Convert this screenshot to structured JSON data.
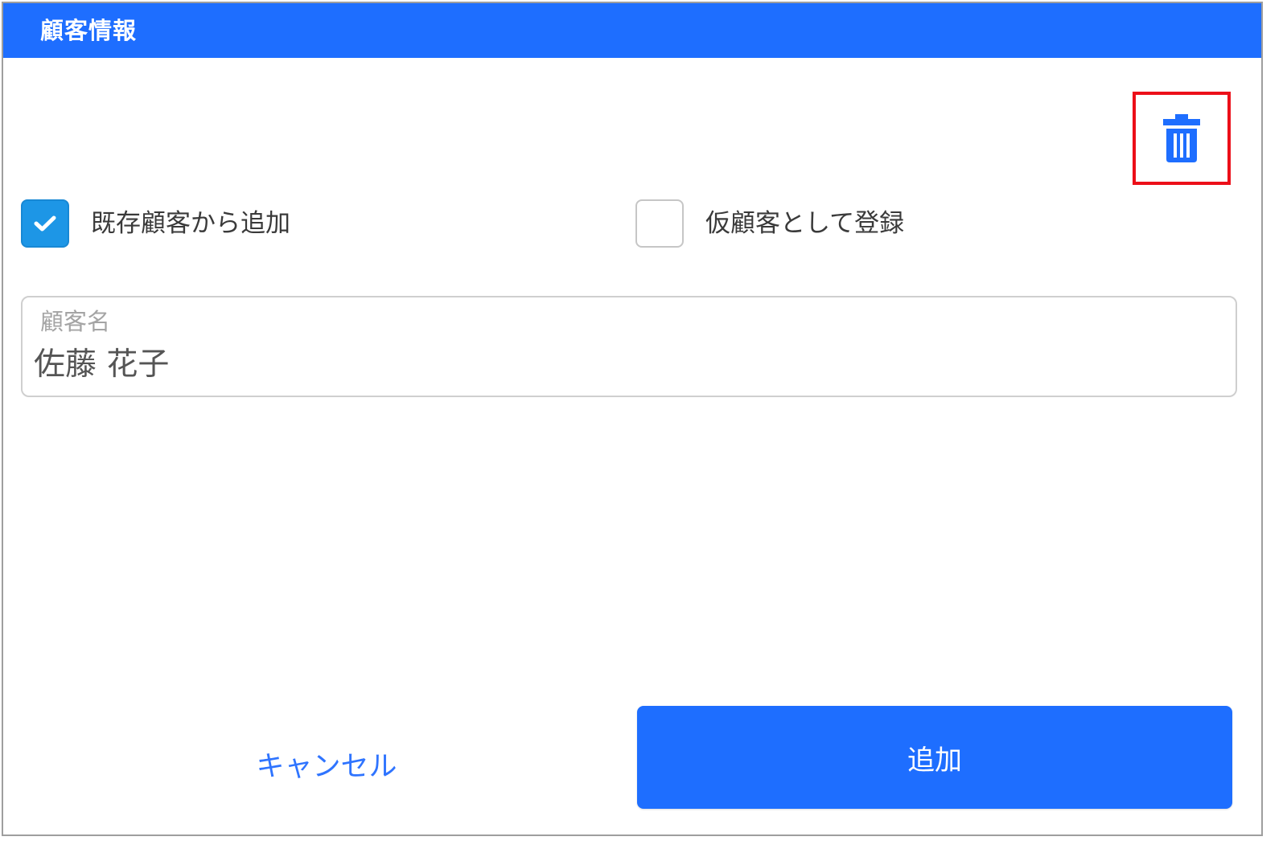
{
  "dialog": {
    "title": "顧客情報"
  },
  "toolbar": {
    "delete_icon": "trash-icon"
  },
  "options": {
    "existing_customer": {
      "label": "既存顧客から追加",
      "checked": true
    },
    "temporary_customer": {
      "label": "仮顧客として登録",
      "checked": false
    }
  },
  "customer_field": {
    "label": "顧客名",
    "value": "佐藤 花子"
  },
  "actions": {
    "cancel_label": "キャンセル",
    "add_label": "追加"
  },
  "colors": {
    "header": "#1e6eff",
    "primary_button": "#1e6eff",
    "checkbox_checked": "#1d96e6",
    "link": "#2f74ff",
    "highlight_border": "#ec0f19"
  }
}
